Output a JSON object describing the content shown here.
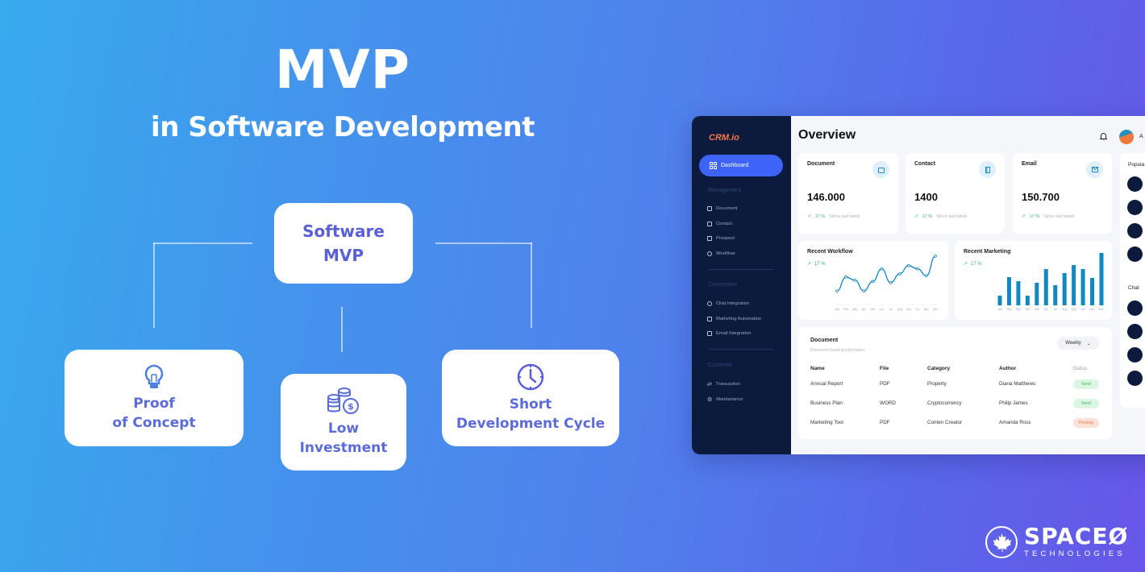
{
  "hero": {
    "title": "MVP",
    "subtitle": "in Software Development"
  },
  "diagram": {
    "center": {
      "line1": "Software",
      "line2": "MVP"
    },
    "nodes": [
      {
        "icon": "lightbulb-icon",
        "line1": "Proof",
        "line2": "of Concept"
      },
      {
        "icon": "coins-dollar-icon",
        "line1": "Low",
        "line2": "Investment"
      },
      {
        "icon": "clock-icon",
        "line1": "Short",
        "line2": "Development Cycle"
      }
    ]
  },
  "dashboard": {
    "logo": "CRM.io",
    "title": "Overview",
    "user_initial": "A",
    "sidebar": {
      "active": {
        "label": "Dashboard",
        "icon": "grid-icon"
      },
      "sections": [
        {
          "heading": "Management",
          "items": [
            {
              "label": "Document",
              "icon": "document-icon"
            },
            {
              "label": "Contact",
              "icon": "contact-book-icon"
            },
            {
              "label": "Prospect",
              "icon": "cart-icon"
            },
            {
              "label": "Workflow",
              "icon": "refresh-icon"
            }
          ]
        },
        {
          "heading": "Connection",
          "items": [
            {
              "label": "Chat Integration",
              "icon": "chat-icon"
            },
            {
              "label": "Marketing Automation",
              "icon": "briefcase-icon"
            },
            {
              "label": "Email Integration",
              "icon": "mail-icon"
            }
          ]
        },
        {
          "heading": "Customer",
          "items": [
            {
              "label": "Transaction",
              "icon": "arrows-swap-icon"
            },
            {
              "label": "Maintenance",
              "icon": "gear-icon"
            }
          ]
        }
      ]
    },
    "stats": [
      {
        "label": "Document",
        "value": "146.000",
        "change": "17 %",
        "period": "Since last week",
        "icon": "document-icon"
      },
      {
        "label": "Contact",
        "value": "1400",
        "change": "17 %",
        "period": "Since last week",
        "icon": "contact-book-icon"
      },
      {
        "label": "Email",
        "value": "150.700",
        "change": "17 %",
        "period": "Since last week",
        "icon": "mail-icon"
      }
    ],
    "right_panel": {
      "popular_heading": "Popula",
      "chat_heading": "Chat"
    },
    "document_table": {
      "title": "Document",
      "subtitle": "Document tracking information",
      "filter": "Weekly",
      "columns": [
        "Name",
        "File",
        "Category",
        "Author",
        "Status"
      ],
      "rows": [
        {
          "name": "Annual Report",
          "file": "PDF",
          "category": "Property",
          "author": "Diana Matthews",
          "status": "Send"
        },
        {
          "name": "Business Plan",
          "file": "WORD",
          "category": "Cryptocurrency",
          "author": "Philip James",
          "status": "Send"
        },
        {
          "name": "Marketing Tool",
          "file": "PDF",
          "category": "Conten Creator",
          "author": "Amanda Ross",
          "status": "Pending"
        }
      ]
    },
    "colors": {
      "accent": "#3d64f6",
      "sidebar": "#0c1a3d",
      "chart": "#1188c0",
      "positive": "#35b36a",
      "pending": "#ef7a55",
      "logo": "#f2784b"
    }
  },
  "chart_data": [
    {
      "type": "line",
      "title": "Recent Workflow",
      "change": "17 %",
      "categories": [
        "Jan",
        "Feb",
        "Mar",
        "Apr",
        "Mei",
        "Jun",
        "Jul",
        "Aug",
        "Sep",
        "Oct",
        "Nov",
        "Dec"
      ],
      "values": [
        10,
        32,
        27,
        10,
        25,
        45,
        23,
        37,
        50,
        45,
        34,
        65
      ],
      "ylim": [
        0,
        70
      ]
    },
    {
      "type": "bar",
      "title": "Recent Marketing",
      "change": "17 %",
      "categories": [
        "Jan",
        "Feb",
        "Mar",
        "Jun",
        "Mei",
        "Jun",
        "Jul",
        "Aug",
        "Sep",
        "Oct",
        "Nov",
        "Dec"
      ],
      "values": [
        12,
        35,
        30,
        12,
        28,
        45,
        25,
        40,
        50,
        45,
        34,
        65
      ],
      "ylim": [
        0,
        70
      ]
    }
  ],
  "brand": {
    "name": "SPACEØ",
    "tagline": "TECHNOLOGIES",
    "icon": "maple-leaf-icon"
  }
}
